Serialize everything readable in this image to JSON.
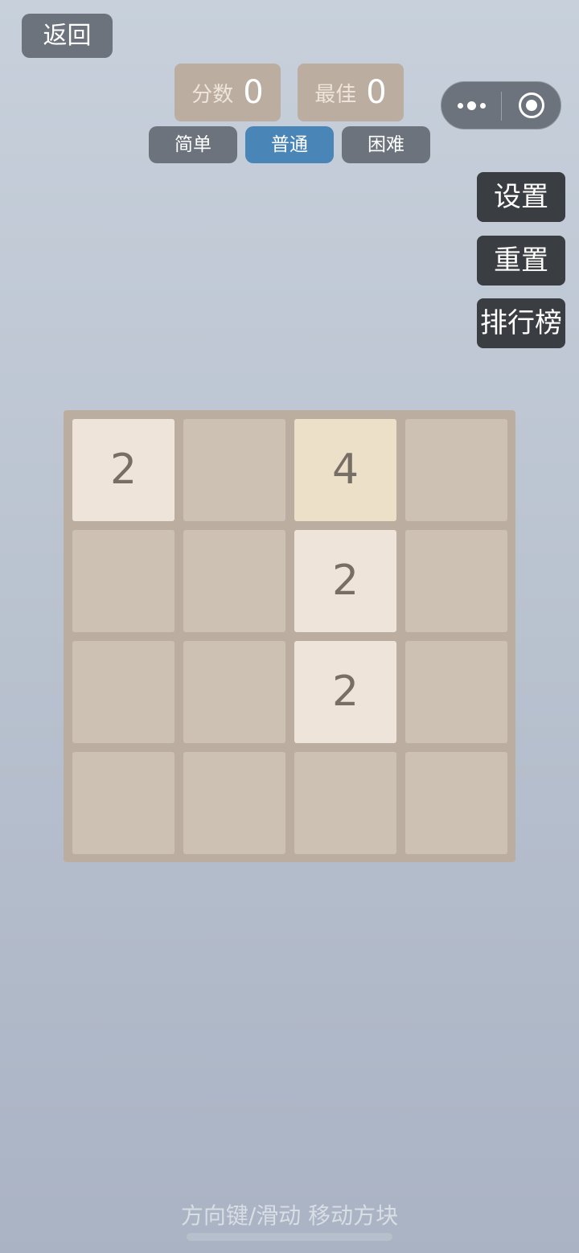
{
  "back": {
    "label": "返回"
  },
  "scores": {
    "current_label": "分数",
    "current_value": "0",
    "best_label": "最佳",
    "best_value": "0"
  },
  "modes": {
    "easy": "简单",
    "normal": "普通",
    "hard": "困难",
    "selected": "normal"
  },
  "side_menu": {
    "settings": "设置",
    "reset": "重置",
    "leaderboard": "排行榜"
  },
  "board": {
    "size": 4,
    "cells": [
      [
        "2",
        "",
        "4",
        ""
      ],
      [
        "",
        "",
        "2",
        ""
      ],
      [
        "",
        "",
        "2",
        ""
      ],
      [
        "",
        "",
        "",
        ""
      ]
    ]
  },
  "hint": "方向键/滑动 移动方块",
  "colors": {
    "board": "#bbada0",
    "empty_cell": "#cdc1b4",
    "tile_2": "#eee4da",
    "tile_4": "#ede0c8",
    "tile_text": "#776e65",
    "selected_mode": "#4a85b7",
    "button": "#6c737c",
    "side_button": "#3a3d41"
  },
  "icons": {
    "capsule_more": "more-dots-icon",
    "capsule_close": "target-circle-icon"
  }
}
